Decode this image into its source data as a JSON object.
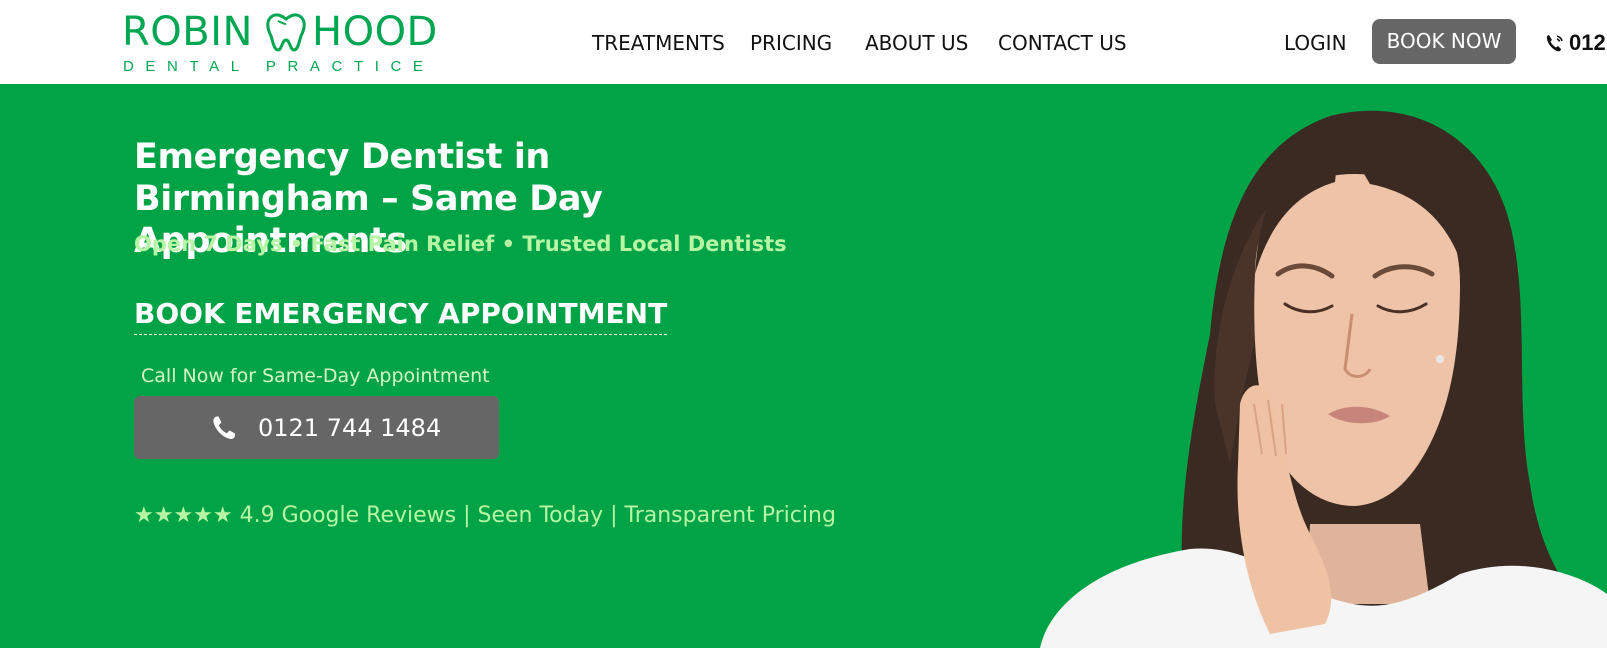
{
  "header": {
    "logo": {
      "name_left": "ROBIN",
      "name_right": "HOOD",
      "tagline": "DENTAL PRACTICE"
    },
    "nav": [
      {
        "label": "TREATMENTS"
      },
      {
        "label": "PRICING"
      },
      {
        "label": "ABOUT US"
      },
      {
        "label": "CONTACT US"
      }
    ],
    "login_label": "LOGIN",
    "book_label": "BOOK NOW",
    "phone_partial": "012",
    "phone_icon": "phone-ringing-icon"
  },
  "hero": {
    "title": "Emergency Dentist in Birmingham – Same Day Appointments",
    "subtitle": "Open 7 Days • Fast Pain Relief • Trusted Local Dentists",
    "book_heading": "BOOK EMERGENCY APPOINTMENT",
    "call_label": "Call Now for Same-Day Appointment",
    "call_number": "0121 744 1484",
    "call_icon": "phone-icon",
    "reviews": "★★★★★ 4.9 Google Reviews | Seen Today | Transparent Pricing"
  },
  "colors": {
    "brand_green": "#00a651",
    "hero_bg": "#00a346",
    "accent_light_green": "#b6f5a4",
    "button_grey": "#666666"
  }
}
